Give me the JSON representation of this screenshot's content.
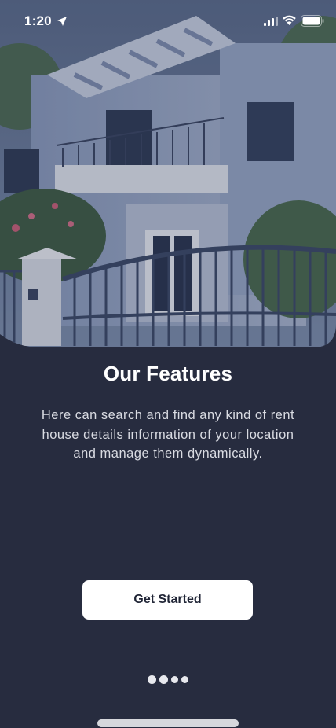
{
  "status_bar": {
    "time": "1:20",
    "icons": [
      "location-arrow-icon",
      "cellular-signal-icon",
      "wifi-icon",
      "battery-icon"
    ]
  },
  "hero": {
    "image": "two-story-house-photo"
  },
  "onboarding": {
    "title": "Our Features",
    "description": "Here can search and find any kind of rent house details information of your location and manage them dynamically.",
    "cta_label": "Get Started"
  },
  "pager": {
    "total": 4,
    "current": 1
  },
  "colors": {
    "background": "#272c3f",
    "button_bg": "#ffffff",
    "button_text": "#1f2435",
    "title": "#ffffff",
    "body_text": "#d9dbe2"
  }
}
